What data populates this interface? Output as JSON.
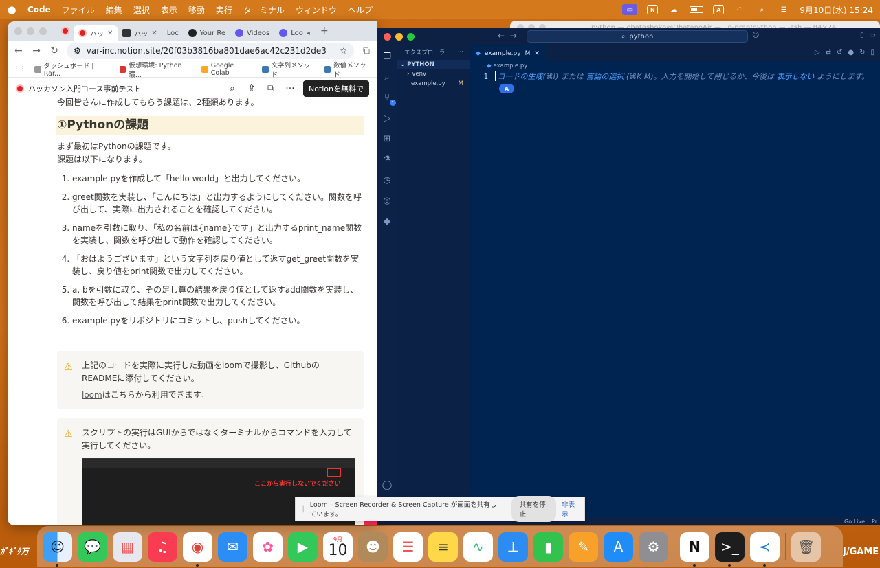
{
  "menubar": {
    "app": "Code",
    "items": [
      "ファイル",
      "編集",
      "選択",
      "表示",
      "移動",
      "実行",
      "ターミナル",
      "ウィンドウ",
      "ヘルプ"
    ],
    "clock": "9月10日(水) 15:24",
    "input_indicator": "A"
  },
  "bg_terminal": {
    "title": "python — ohatashoko@OhatanoAir — ..p-prep/python — -zsh — 84×24"
  },
  "chrome": {
    "tabs": [
      {
        "label": "ハッ",
        "icon": "notion-red-circle-icon"
      },
      {
        "label": "ハッ",
        "icon": "notion-icon"
      },
      {
        "label": "Loc",
        "icon": "loom-icon"
      },
      {
        "label": "Your Re",
        "icon": "github-icon"
      },
      {
        "label": "Videos",
        "icon": "loom-videos-icon"
      },
      {
        "label": "Loo",
        "icon": "loom-icon"
      }
    ],
    "url": "var-inc.notion.site/20f03b3816ba801dae6ac42c231d2de3",
    "bookmarks": [
      "ダッシュボード | Rar...",
      "仮想環境: Python環...",
      "Google Colab",
      "文字列メソッド",
      "数値メソッド"
    ]
  },
  "notion": {
    "page_title": "ハッカソン入門コース事前テスト",
    "cta": "Notionを無料で",
    "cut_text": "今回皆さんに作成してもらう課題は、2種類あります。",
    "heading": "①Pythonの課題",
    "intro1": "まず最初はPythonの課題です。",
    "intro2": "課題は以下になります。",
    "tasks": [
      "example.pyを作成して「hello world」と出力してください。",
      "greet関数を実装し、「こんにちは」と出力するようにしてください。関数を呼び出して、実際に出力されることを確認してください。",
      "nameを引数に取り、「私の名前は{name}です」と出力するprint_name関数を実装し、関数を呼び出して動作を確認してください。",
      "「おはようございます」という文字列を戻り値として返すget_greet関数を実装し、戻り値をprint関数で出力してください。",
      "a, bを引数に取り、その足し算の結果を戻り値として返すadd関数を実装し、関数を呼び出して結果をprint関数で出力してください。",
      "example.pyをリポジトリにコミットし、pushしてください。"
    ],
    "callout1_text": "上記のコードを実際に実行した動画をloomで撮影し、GithubのREADMEに添付してください。",
    "callout1_link": "loom",
    "callout1_link_suffix": "はこちらから利用できます。",
    "callout2_text": "スクリプトの実行はGUIからではなくターミナルからコマンドを入力して実行してください。",
    "shot_label": "ここから実行しないでください"
  },
  "vscode": {
    "search": "python",
    "explorer_title": "エクスプローラー",
    "project": "PYTHON",
    "folders": [
      "venv"
    ],
    "files": [
      {
        "name": "example.py",
        "status": "M"
      }
    ],
    "tab": {
      "name": "example.py",
      "status": "M"
    },
    "breadcrumb": "example.py",
    "line_no": "1",
    "hint": {
      "p1": "コードの生成",
      "p2": "(⌘I) または ",
      "p3": "言語の選択",
      "p4": " (⌘K M)。入力を開始して閉じるか、今後は ",
      "p5": "表示しない",
      "p6": " ようにします。"
    },
    "cursor_label": "A",
    "status_golive": "Go Live",
    "status_pr": "Pr"
  },
  "loom": {
    "message": "Loom – Screen Recorder & Screen Capture が画面を共有しています。",
    "stop": "共有を停止",
    "hide": "非表示"
  },
  "dock": {
    "calendar_month": "9月",
    "calendar_day": "10",
    "right_deco": "J/GAME"
  }
}
